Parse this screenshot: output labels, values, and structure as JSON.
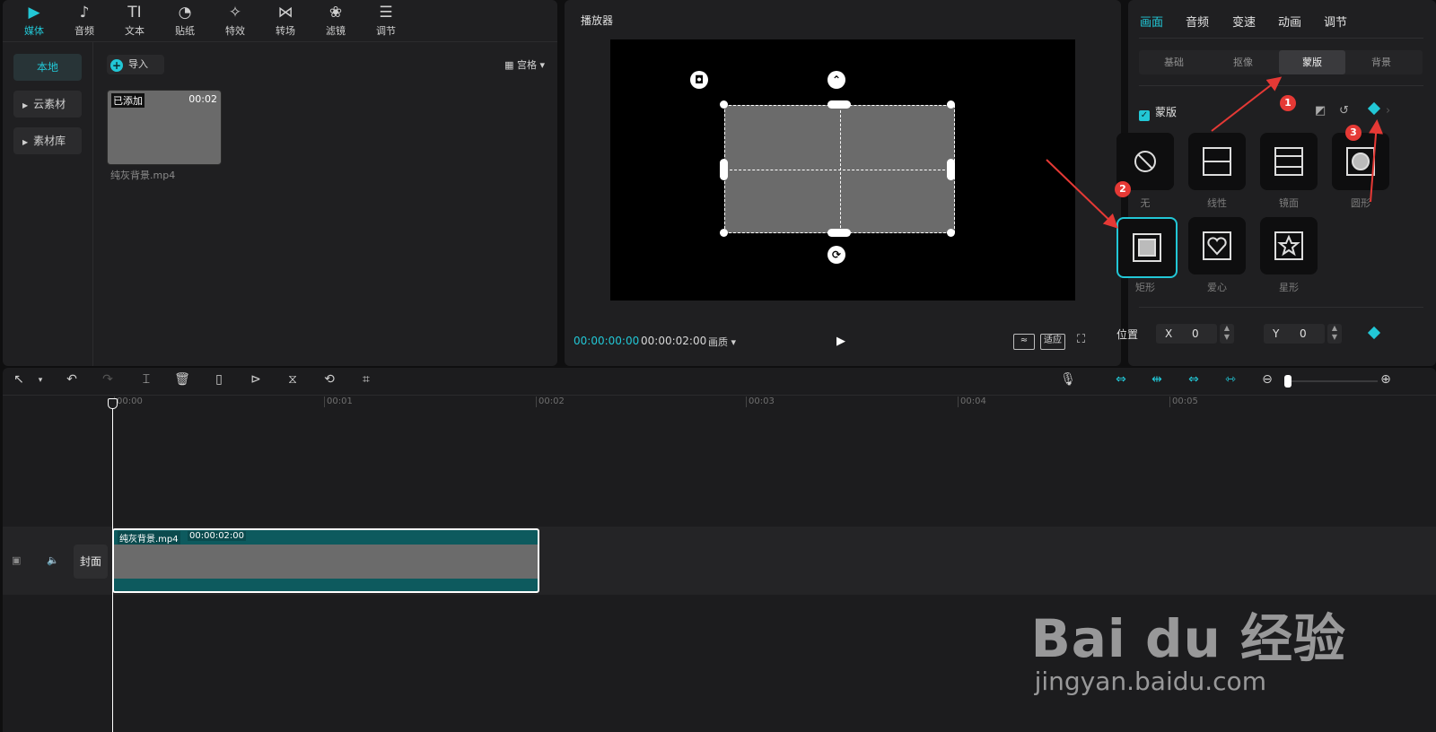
{
  "media": {
    "tabs": [
      {
        "label": "媒体",
        "icon": "media-icon",
        "glyph": "▶"
      },
      {
        "label": "音频",
        "icon": "audio-icon",
        "glyph": "♪"
      },
      {
        "label": "文本",
        "icon": "text-icon",
        "glyph": "TI"
      },
      {
        "label": "贴纸",
        "icon": "sticker-icon",
        "glyph": "◔"
      },
      {
        "label": "特效",
        "icon": "effects-icon",
        "glyph": "✧"
      },
      {
        "label": "转场",
        "icon": "transition-icon",
        "glyph": "⋈"
      },
      {
        "label": "滤镜",
        "icon": "filter-icon",
        "glyph": "❀"
      },
      {
        "label": "调节",
        "icon": "adjust-icon",
        "glyph": "☰"
      }
    ],
    "nav": [
      "本地",
      "云素材",
      "素材库"
    ],
    "import_label": "导入",
    "view_label": "宫格",
    "clip": {
      "badge": "已添加",
      "duration": "00:02",
      "name": "纯灰背景.mp4"
    }
  },
  "player": {
    "title": "播放器",
    "current_time": "00:00:00:00",
    "total_time": "00:00:02:00",
    "quality_label": "画质",
    "fit_label": "适应"
  },
  "inspector": {
    "tabs": [
      "画面",
      "音频",
      "变速",
      "动画",
      "调节"
    ],
    "subtabs": [
      "基础",
      "抠像",
      "蒙版",
      "背景"
    ],
    "mask_label": "蒙版",
    "masks": [
      "无",
      "线性",
      "镜面",
      "圆形",
      "矩形",
      "爱心",
      "星形"
    ],
    "position_label": "位置",
    "x_key": "X",
    "x_value": "0",
    "y_key": "Y",
    "y_value": "0"
  },
  "annotations": [
    "1",
    "2",
    "3"
  ],
  "timeline": {
    "ticks": [
      "00:00",
      "00:01",
      "00:02",
      "00:03",
      "00:04",
      "00:05"
    ],
    "cover_label": "封面",
    "clip_name": "纯灰背景.mp4",
    "clip_time": "00:00:02:00"
  },
  "watermark": {
    "brand": "Bai du 经验",
    "url": "jingyan.baidu.com"
  },
  "colors": {
    "accent": "#22c7d6",
    "annotation": "#e53935",
    "clip": "#0d5a5e"
  }
}
